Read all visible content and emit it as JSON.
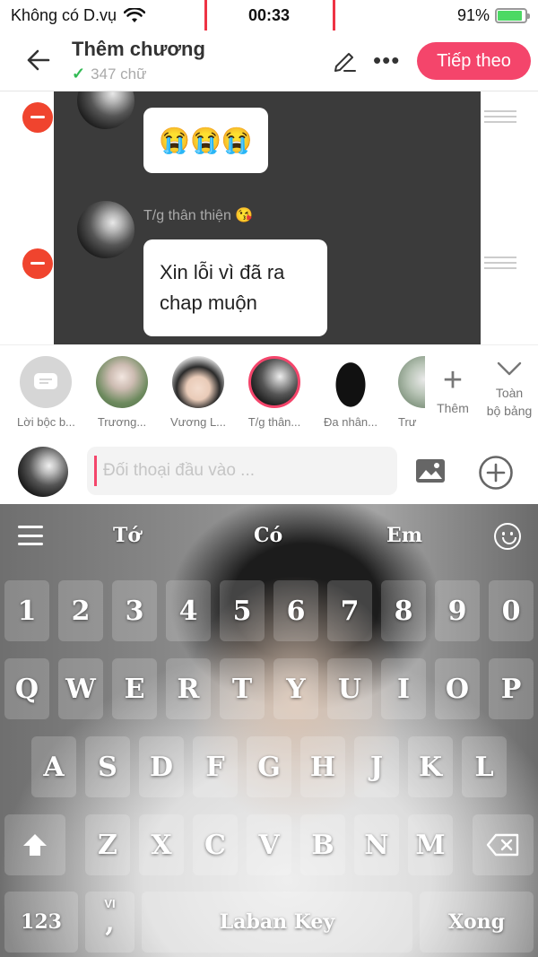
{
  "status_bar": {
    "carrier": "Không có D.vụ",
    "time": "00:33",
    "battery": "91%",
    "battery_level": 0.91
  },
  "header": {
    "title": "Thêm chương",
    "word_count": "347 chữ",
    "next_label": "Tiếp theo"
  },
  "chat": {
    "messages": [
      {
        "sender": "",
        "text": "😭😭😭"
      },
      {
        "sender": "T/g thân thiện 😘",
        "text": "Xin lỗi vì đã ra chap muộn"
      }
    ]
  },
  "characters": {
    "items": [
      {
        "label": "Lời bộc b..."
      },
      {
        "label": "Trương..."
      },
      {
        "label": "Vương L..."
      },
      {
        "label": "T/g thân..."
      },
      {
        "label": "Đa nhân..."
      },
      {
        "label": "Trư"
      }
    ],
    "add_label": "Thêm",
    "board_label_line1": "Toàn",
    "board_label_line2": "bộ bảng"
  },
  "input": {
    "placeholder": "Đối thoại đầu vào ..."
  },
  "keyboard": {
    "suggestions": [
      "Tớ",
      "Có",
      "Em"
    ],
    "number_row": [
      "1",
      "2",
      "3",
      "4",
      "5",
      "6",
      "7",
      "8",
      "9",
      "0"
    ],
    "row1": [
      "Q",
      "W",
      "E",
      "R",
      "T",
      "Y",
      "U",
      "I",
      "O",
      "P"
    ],
    "row2": [
      "A",
      "S",
      "D",
      "F",
      "G",
      "H",
      "J",
      "K",
      "L"
    ],
    "row3": [
      "Z",
      "X",
      "C",
      "V",
      "B",
      "N",
      "M"
    ],
    "mode_key": "123",
    "comma_key": ",",
    "comma_hint": "VI",
    "space_key": "Laban Key",
    "enter_key": "Xong"
  }
}
